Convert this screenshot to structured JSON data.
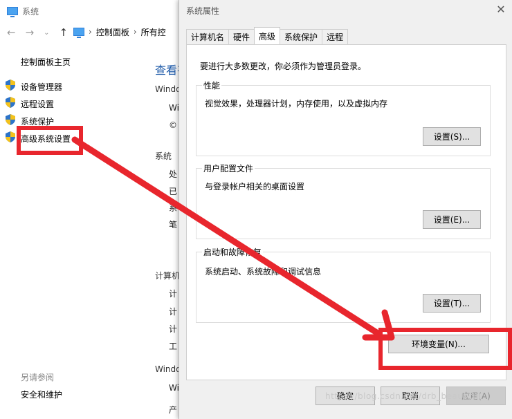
{
  "background_window": {
    "title": "系统",
    "breadcrumb": [
      "控制面板",
      "所有控"
    ],
    "sidebar_home": "控制面板主页",
    "sidebar_items": [
      "设备管理器",
      "远程设置",
      "系统保护",
      "高级系统设置"
    ],
    "see_also_heading": "另请参阅",
    "see_also_items": [
      "安全和维护"
    ],
    "main_heading": "查看有",
    "main_lines": [
      "Windo",
      "Wi",
      "©",
      "系统",
      "处",
      "已",
      "系",
      "笔",
      "计算机",
      "计",
      "计",
      "计",
      "工",
      "Windo",
      "Wi",
      "产"
    ]
  },
  "dialog": {
    "title": "系统属性",
    "close_symbol": "✕",
    "tabs": [
      "计算机名",
      "硬件",
      "高级",
      "系统保护",
      "远程"
    ],
    "active_tab": "高级",
    "admin_note": "要进行大多数更改，你必须作为管理员登录。",
    "performance": {
      "label": "性能",
      "desc": "视觉效果，处理器计划，内存使用，以及虚拟内存",
      "button": "设置(S)..."
    },
    "user_profiles": {
      "label": "用户配置文件",
      "desc": "与登录帐户相关的桌面设置",
      "button": "设置(E)..."
    },
    "startup_recovery": {
      "label": "启动和故障恢复",
      "desc": "系统启动、系统故障和调试信息",
      "button": "设置(T)..."
    },
    "env_button": "环境变量(N)...",
    "ok_button": "确定",
    "cancel_button": "取消",
    "apply_button": "应用(A)"
  },
  "annotation_color": "#e8262d",
  "watermark": "https://blog.csdn.net/drb_beautiful"
}
